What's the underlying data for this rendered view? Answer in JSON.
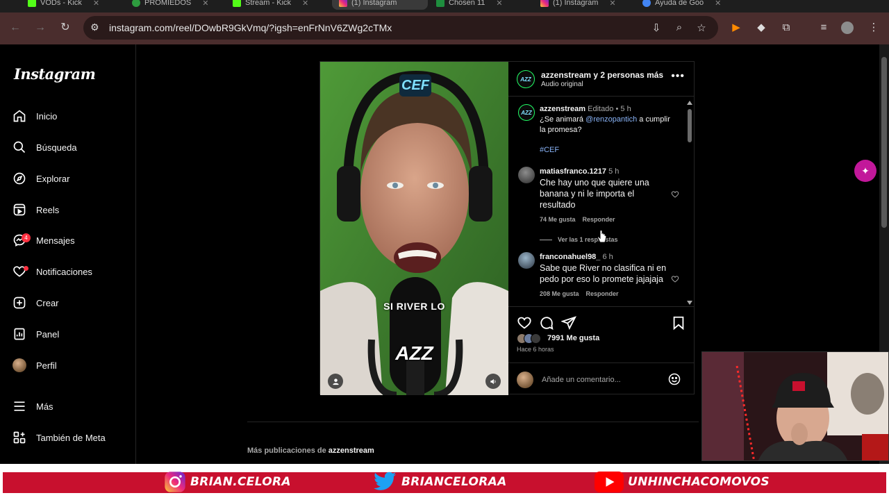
{
  "browser": {
    "tabs": [
      {
        "label": "VODs - Kick"
      },
      {
        "label": "PROMIEDOS"
      },
      {
        "label": "Stream - Kick"
      },
      {
        "label": "(1) Instagram"
      },
      {
        "label": "Chosen 11"
      },
      {
        "label": "(1) Instagram"
      },
      {
        "label": "Ayuda de Goo"
      }
    ],
    "url": "instagram.com/reel/DOwbR9GkVmq/?igsh=enFrNnV6ZWg2cTMx"
  },
  "sidebar": {
    "logo": "Instagram",
    "items": [
      {
        "label": "Inicio"
      },
      {
        "label": "Búsqueda"
      },
      {
        "label": "Explorar"
      },
      {
        "label": "Reels"
      },
      {
        "label": "Mensajes",
        "badge": "4"
      },
      {
        "label": "Notificaciones"
      },
      {
        "label": "Crear"
      },
      {
        "label": "Panel"
      },
      {
        "label": "Perfil"
      },
      {
        "label": "Más"
      },
      {
        "label": "También de Meta"
      }
    ]
  },
  "reel": {
    "video": {
      "caption": "SI RIVER LO",
      "badge_top": "CEF",
      "mic_logo": "AZZ"
    },
    "header": {
      "title": "azzenstream y 2 personas más",
      "subtitle": "Audio original",
      "avatar_text": "AZZ"
    },
    "post": {
      "user": "azzenstream",
      "edited": "Editado",
      "sep": "•",
      "time": "5 h",
      "text_before": "¿Se animará",
      "mention": "@renzopantich",
      "text_after": "a cumplir la promesa?",
      "hashtag": "#CEF"
    },
    "comments": [
      {
        "user": "matiasfranco.1217",
        "time": "5 h",
        "text": "Che hay uno que quiere una banana y ni le importa el resultado",
        "likes": "74 Me gusta",
        "reply": "Responder",
        "view_replies": "Ver las 1 respuestas"
      },
      {
        "user": "franconahuel98_",
        "time": "6 h",
        "text": "Sabe que River no clasifica ni en pedo por eso lo promete jajajaja",
        "likes": "208 Me gusta",
        "reply": "Responder"
      }
    ],
    "likes": "7991 Me gusta",
    "when": "Hace 6 horas",
    "comment_placeholder": "Añade un comentario..."
  },
  "more_posts": {
    "prefix": "Más publicaciones de",
    "user": "azzenstream"
  },
  "overlay": {
    "instagram": "BRIAN.CELORA",
    "twitter": "BRIANCELORAA",
    "youtube": "UNHINCHACOMOVOS"
  },
  "colors": {
    "toolbar": "#4a2d2d",
    "accent_link": "#8ab4f8",
    "notification_red": "#ff3040",
    "overlay_red": "#c8102e"
  }
}
